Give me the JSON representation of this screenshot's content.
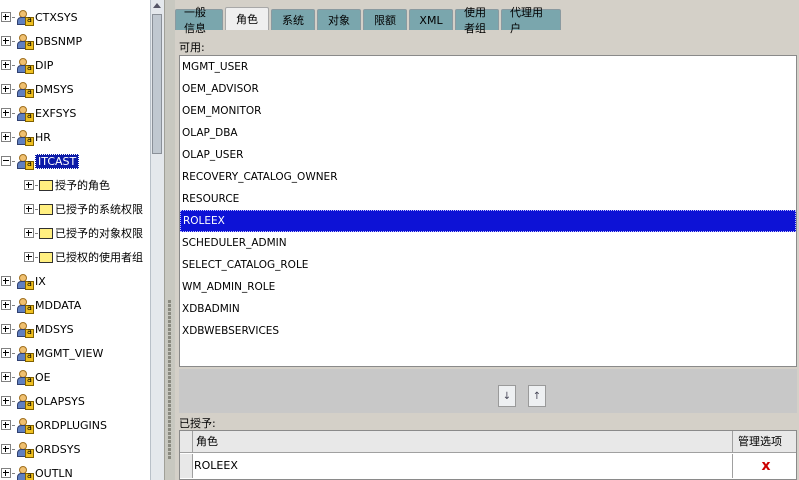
{
  "tree": {
    "users_top": [
      "CTXSYS",
      "DBSNMP",
      "DIP",
      "DMSYS",
      "EXFSYS",
      "HR"
    ],
    "selected_user": "ITCAST",
    "children": [
      "授予的角色",
      "已授予的系统权限",
      "已授予的对象权限",
      "已授权的使用者组"
    ],
    "users_bottom": [
      "IX",
      "MDDATA",
      "MDSYS",
      "MGMT_VIEW",
      "OE",
      "OLAPSYS",
      "ORDPLUGINS",
      "ORDSYS",
      "OUTLN"
    ]
  },
  "tabs": [
    {
      "label": "一般信息",
      "active": false
    },
    {
      "label": "角色",
      "active": true
    },
    {
      "label": "系统",
      "active": false
    },
    {
      "label": "对象",
      "active": false
    },
    {
      "label": "限额",
      "active": false
    },
    {
      "label": "XML",
      "active": false
    },
    {
      "label": "使用者组",
      "active": false
    },
    {
      "label": "代理用户",
      "active": false
    }
  ],
  "available": {
    "label": "可用:",
    "roles": [
      "MGMT_USER",
      "OEM_ADVISOR",
      "OEM_MONITOR",
      "OLAP_DBA",
      "OLAP_USER",
      "RECOVERY_CATALOG_OWNER",
      "RESOURCE",
      "ROLEEX",
      "SCHEDULER_ADMIN",
      "SELECT_CATALOG_ROLE",
      "WM_ADMIN_ROLE",
      "XDBADMIN",
      "XDBWEBSERVICES"
    ],
    "selected": "ROLEEX"
  },
  "move_buttons": {
    "down_glyph": "↓",
    "up_glyph": "↑"
  },
  "granted": {
    "label": "已授予:",
    "columns": {
      "role": "角色",
      "admin": "管理选项"
    },
    "rows": [
      {
        "role": "ROLEEX",
        "admin_mark": "x"
      }
    ]
  },
  "colors": {
    "selection": "#0d12d6",
    "tab_bg": "#7aa6ad",
    "admin_mark": "#cc0000"
  }
}
